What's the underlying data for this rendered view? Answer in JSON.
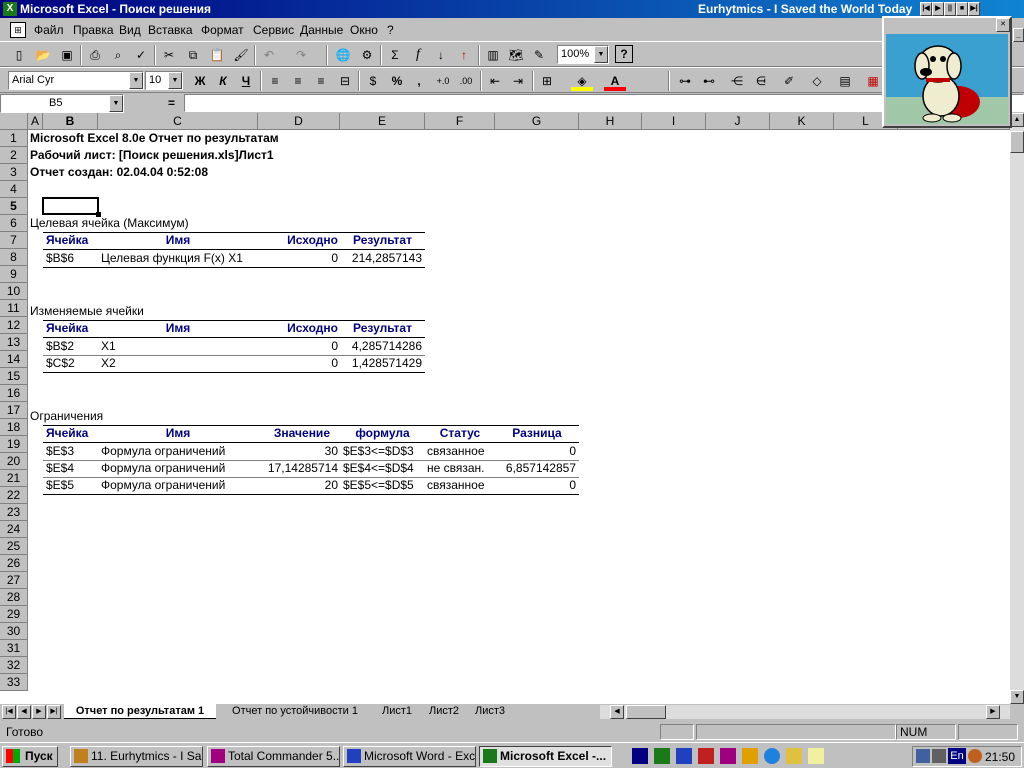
{
  "window": {
    "title": "Microsoft Excel - Поиск решения",
    "now_playing": "Eurhytmics - I Saved the World Today"
  },
  "menu": [
    "Файл",
    "Правка",
    "Вид",
    "Вставка",
    "Формат",
    "Сервис",
    "Данные",
    "Окно",
    "?"
  ],
  "toolbar": {
    "zoom": "100%",
    "font_name": "Arial Cyr",
    "font_size": "10",
    "bold_label": "Ж",
    "italic_label": "К",
    "underline_label": "Ч",
    "sigma_label": "Σ",
    "fx_label": "f",
    "percent_label": "%",
    "comma_label": ","
  },
  "formula_bar": {
    "name_box": "B5",
    "equals": "=",
    "content": ""
  },
  "columns": [
    "A",
    "B",
    "C",
    "D",
    "E",
    "F",
    "G",
    "H",
    "I",
    "J",
    "K",
    "L"
  ],
  "rows": [
    "1",
    "2",
    "3",
    "4",
    "5",
    "6",
    "7",
    "8",
    "9",
    "10",
    "11",
    "12",
    "13",
    "14",
    "15",
    "16",
    "17",
    "18",
    "19",
    "20",
    "21",
    "22",
    "23",
    "24",
    "25",
    "26",
    "27",
    "28",
    "29",
    "30",
    "31",
    "32",
    "33"
  ],
  "report": {
    "title": "Microsoft Excel 8.0e Отчет по результатам",
    "worksheet": "Рабочий лист: [Поиск решения.xls]Лист1",
    "created": "Отчет создан: 02.04.04 0:52:08",
    "target": {
      "heading": "Целевая ячейка (Максимум)",
      "headers": [
        "Ячейка",
        "Имя",
        "Исходно",
        "Результат"
      ],
      "rows": [
        [
          "$B$6",
          "Целевая функция F(x) X1",
          "0",
          "214,2857143"
        ]
      ]
    },
    "changing": {
      "heading": "Изменяемые ячейки",
      "headers": [
        "Ячейка",
        "Имя",
        "Исходно",
        "Результат"
      ],
      "rows": [
        [
          "$B$2",
          "X1",
          "0",
          "4,285714286"
        ],
        [
          "$C$2",
          "X2",
          "0",
          "1,428571429"
        ]
      ]
    },
    "constraints": {
      "heading": "Ограничения",
      "headers": [
        "Ячейка",
        "Имя",
        "Значение",
        "формула",
        "Статус",
        "Разница"
      ],
      "rows": [
        [
          "$E$3",
          "Формула ограничений",
          "30",
          "$E$3<=$D$3",
          "связанное",
          "0"
        ],
        [
          "$E$4",
          "Формула ограничений",
          "17,14285714",
          "$E$4<=$D$4",
          "не связан.",
          "6,857142857"
        ],
        [
          "$E$5",
          "Формула ограничений",
          "20",
          "$E$5<=$D$5",
          "связанное",
          "0"
        ]
      ]
    }
  },
  "sheet_tabs": [
    "Отчет по результатам 1",
    "Отчет по устойчивости 1",
    "Лист1",
    "Лист2",
    "Лист3"
  ],
  "status": {
    "ready": "Готово",
    "num": "NUM"
  },
  "taskbar": {
    "start": "Пуск",
    "tasks": [
      "11. Eurhytmics - I Sa...",
      "Total Commander 5....",
      "Microsoft Word - Exc...",
      "Microsoft Excel -..."
    ],
    "lang": "En",
    "clock": "21:50"
  },
  "colors": {
    "title_start": "#000080",
    "title_end": "#1084d0",
    "header_text": "#000080",
    "chrome": "#c0c0c0"
  }
}
